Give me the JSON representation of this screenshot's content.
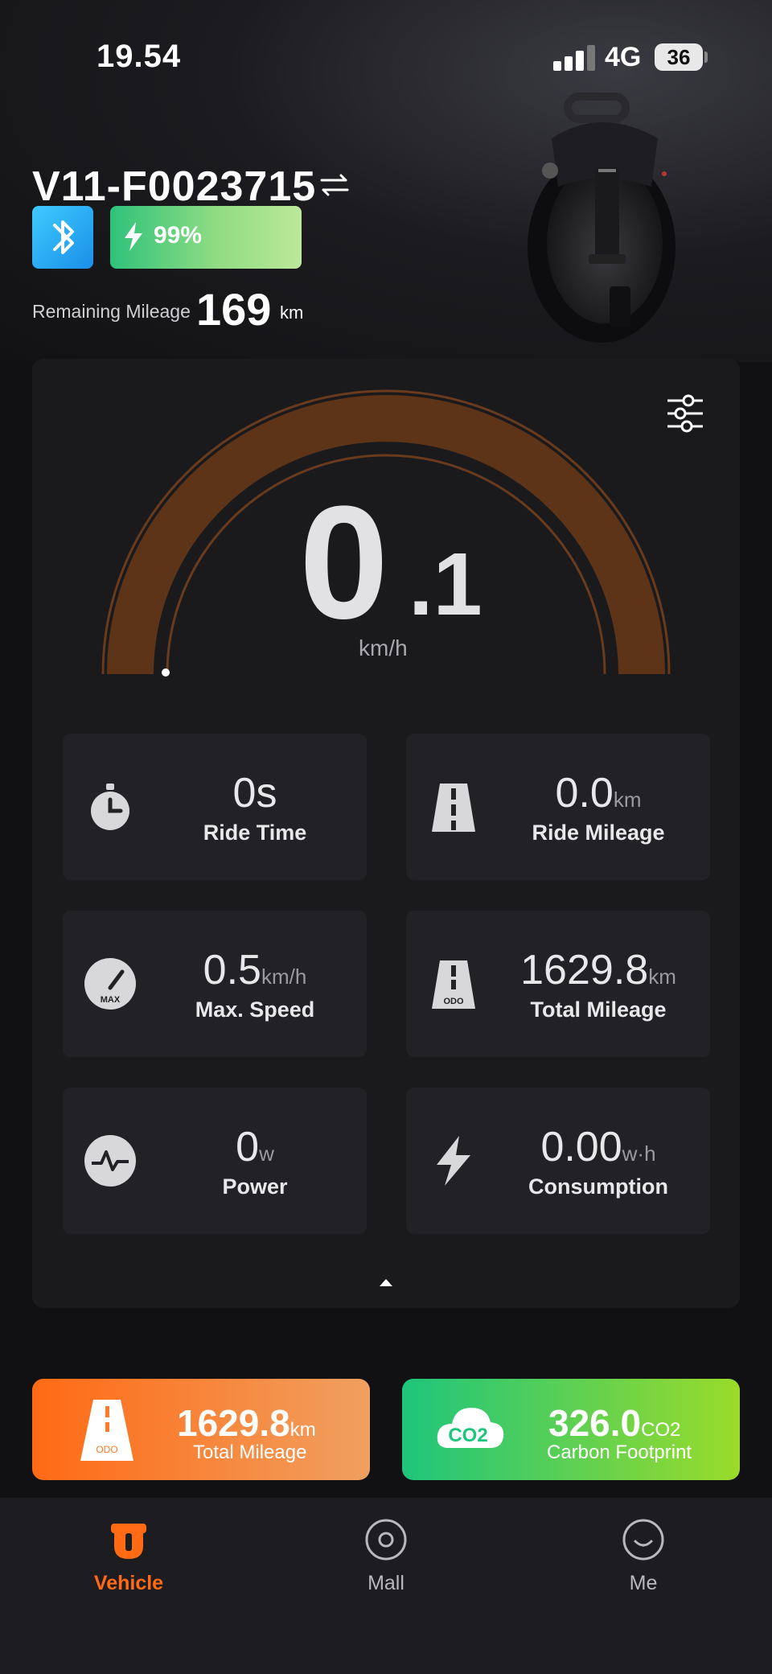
{
  "status_bar": {
    "time": "19.54",
    "network": "4G",
    "battery": "36"
  },
  "device": {
    "name": "V11-F0023715",
    "battery_percent": "99%",
    "remaining_mileage_label": "Remaining Mileage",
    "remaining_mileage_value": "169",
    "remaining_mileage_unit": "km"
  },
  "speed": {
    "integer": "0",
    "decimal": ".1",
    "unit": "km/h"
  },
  "metrics": [
    {
      "value": "0s",
      "unit": "",
      "label": "Ride Time",
      "icon": "stopwatch-icon"
    },
    {
      "value": "0.0",
      "unit": "km",
      "label": "Ride Mileage",
      "icon": "road-icon"
    },
    {
      "value": "0.5",
      "unit": "km/h",
      "label": "Max. Speed",
      "icon": "max-speed-gauge-icon"
    },
    {
      "value": "1629.8",
      "unit": "km",
      "label": "Total Mileage",
      "icon": "odo-road-icon"
    },
    {
      "value": "0",
      "unit": "w",
      "label": "Power",
      "icon": "power-wave-icon"
    },
    {
      "value": "0.00",
      "unit": "w·h",
      "label": "Consumption",
      "icon": "lightning-icon"
    }
  ],
  "summary": {
    "total_mileage": {
      "value": "1629.8",
      "unit": "km",
      "label": "Total Mileage",
      "icon_text": "ODO"
    },
    "carbon": {
      "value": "326.0",
      "unit": "CO2",
      "label": "Carbon Footprint",
      "icon_text": "CO2"
    }
  },
  "tabs": [
    {
      "label": "Vehicle",
      "active": true
    },
    {
      "label": "Mall",
      "active": false
    },
    {
      "label": "Me",
      "active": false
    }
  ],
  "colors": {
    "accent": "#ff6a14",
    "gauge_arc": "#5e3418",
    "battery_green": "#2ec27a",
    "bluetooth_blue": "#2aaaf5"
  }
}
